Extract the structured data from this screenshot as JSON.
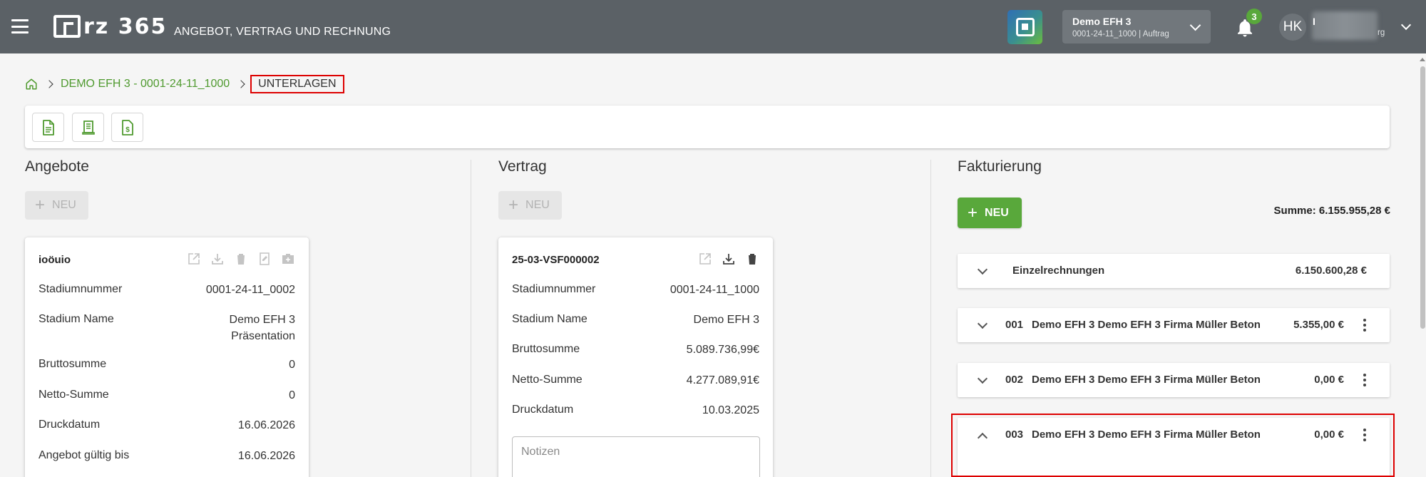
{
  "header": {
    "logo_text": "rz 365",
    "app_title": "ANGEBOT, VERTRAG UND RECHNUNG",
    "project_name": "Demo EFH 3",
    "project_sub": "0001-24-11_1000 | Auftrag",
    "notification_count": "3",
    "avatar_initials": "HK",
    "user_letter": "I",
    "user_suffix": "rg"
  },
  "breadcrumb": {
    "project_link": "DEMO EFH 3 - 0001-24-11_1000",
    "current": "UNTERLAGEN"
  },
  "angebote": {
    "title": "Angebote",
    "new_label": "NEU",
    "card": {
      "title": "ioöuio",
      "rows": [
        {
          "label": "Stadiumnummer",
          "value": "0001-24-11_0002"
        },
        {
          "label": "Stadium Name",
          "value": "Demo EFH 3",
          "value2": "Präsentation"
        },
        {
          "label": "Bruttosumme",
          "value": "0"
        },
        {
          "label": "Netto-Summe",
          "value": "0"
        },
        {
          "label": "Druckdatum",
          "value": "16.06.2026"
        },
        {
          "label": "Angebot gültig bis",
          "value": "16.06.2026"
        }
      ]
    }
  },
  "vertrag": {
    "title": "Vertrag",
    "new_label": "NEU",
    "card": {
      "title": "25-03-VSF000002",
      "rows": [
        {
          "label": "Stadiumnummer",
          "value": "0001-24-11_1000"
        },
        {
          "label": "Stadium Name",
          "value": "Demo EFH 3"
        },
        {
          "label": "Bruttosumme",
          "value": "5.089.736,99€"
        },
        {
          "label": "Netto-Summe",
          "value": "4.277.089,91€"
        },
        {
          "label": "Druckdatum",
          "value": "10.03.2025"
        }
      ],
      "notes_placeholder": "Notizen"
    }
  },
  "fakturierung": {
    "title": "Fakturierung",
    "new_label": "NEU",
    "summe": "Summe: 6.155.955,28 €",
    "rows": [
      {
        "num": "",
        "name": "Einzelrechnungen",
        "amount": "6.150.600,28 €"
      },
      {
        "num": "001",
        "name": "Demo EFH 3 Demo EFH 3 Firma Müller Beton",
        "amount": "5.355,00 €"
      },
      {
        "num": "002",
        "name": "Demo EFH 3 Demo EFH 3 Firma Müller Beton",
        "amount": "0,00 €"
      },
      {
        "num": "003",
        "name": "Demo EFH 3 Demo EFH 3 Firma Müller Beton",
        "amount": "0,00 €"
      }
    ]
  },
  "icons": {
    "menu": "menu-icon",
    "home": "home-icon",
    "bell": "bell-icon",
    "edit": "open-external-icon",
    "download": "download-icon",
    "delete": "trash-icon"
  },
  "colors": {
    "topbar": "#5b6166",
    "accent_green": "#59a83b",
    "link_green": "#4f9a2f",
    "highlight_red": "#dd0000"
  }
}
